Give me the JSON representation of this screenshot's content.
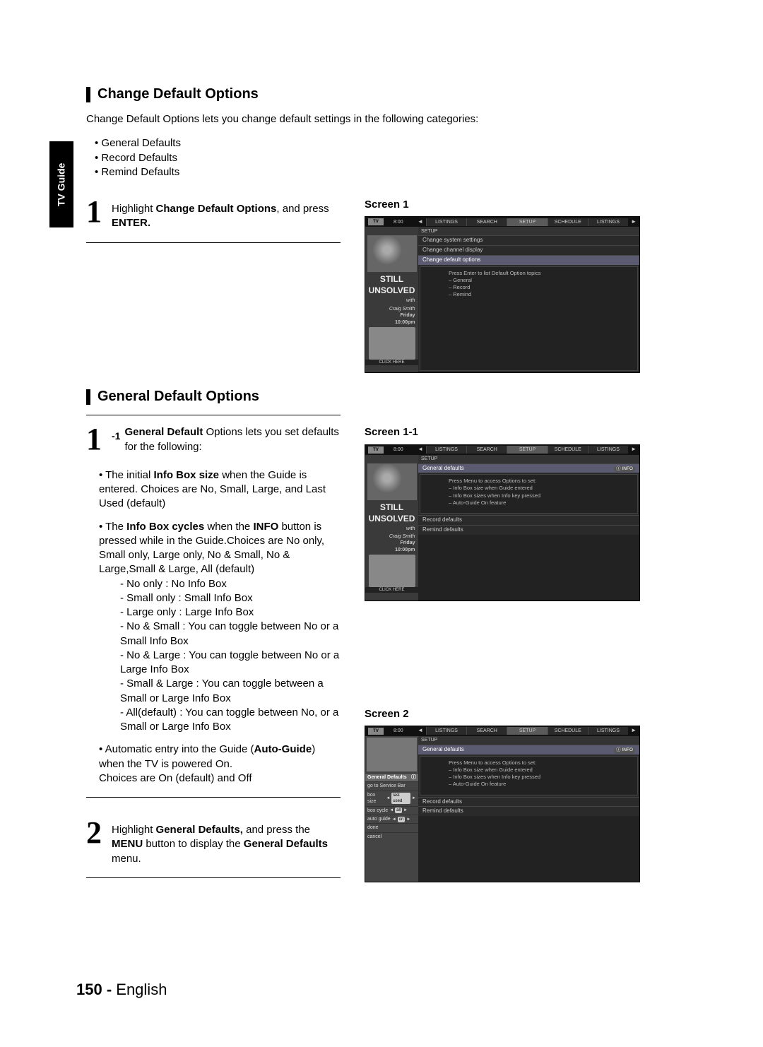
{
  "sideTab": "TV Guide",
  "section1": {
    "title": "Change Default Options",
    "intro": "Change Default Options lets you change default settings in the following categories:",
    "bullets": [
      "• General Defaults",
      "• Record Defaults",
      "• Remind Defaults"
    ],
    "step1": {
      "num": "1",
      "pre": "Highlight ",
      "bold1": "Change Default Options",
      "mid": ", and press ",
      "bold2": "ENTER."
    },
    "screenLabel": "Screen 1"
  },
  "section2": {
    "title": "General Default Options",
    "step1": {
      "num": "1",
      "subnum": "-1",
      "bold1": "General Default",
      "after": " Options lets you set defaults for the following:"
    },
    "b1": {
      "pre": "• The initial ",
      "bold": "Info Box size",
      "after": " when the Guide is entered. Choices are No, Small, Large, and Last Used (default)"
    },
    "b2": {
      "pre": "• The ",
      "bold1": "Info Box cycles",
      "mid": " when the ",
      "bold2": "INFO",
      "after": " button is pressed while in the Guide.Choices are No only, Small only, Large only, No & Small, No & Large,Small & Large, All (default)"
    },
    "b2list": [
      "- No only : No Info Box",
      "- Small only : Small Info Box",
      "- Large only : Large Info Box",
      "- No & Small : You can toggle between No or a Small Info Box",
      "- No & Large : You can toggle between No or a Large Info Box",
      "- Small & Large : You can toggle between a Small or Large Info Box",
      "- All(default) : You can toggle between No, or a Small or Large Info Box"
    ],
    "b3": {
      "pre": "• Automatic entry into the Guide (",
      "bold": "Auto-Guide",
      "mid": ") when the TV is powered On.",
      "after": "Choices are On (default) and Off"
    },
    "step2": {
      "num": "2",
      "pre": "Highlight ",
      "bold1": "General Defaults,",
      "mid": " and press the ",
      "bold2": "MENU",
      "mid2": " button to display the ",
      "bold3": "General Defaults",
      "after": " menu."
    },
    "screenLabel11": "Screen 1-1",
    "screenLabel2": "Screen 2"
  },
  "screens": {
    "logo": "TV",
    "time": "8:00",
    "tabs": [
      "LISTINGS",
      "SEARCH",
      "SETUP",
      "SCHEDULE",
      "LISTINGS"
    ],
    "still1": "STILL",
    "still2": "UNSOLVED",
    "craig": "Craig Smith",
    "with": "with",
    "friday": "Friday",
    "timeShow": "10:00pm",
    "click": "CLICK HERE",
    "arrowL": "◄",
    "arrowR": "►",
    "infoBadge": "ⓘ INFO",
    "s1": {
      "breadcrumb": "SETUP",
      "rows": [
        "Change system settings",
        "Change channel display",
        "Change default options"
      ],
      "paneLines": [
        "Press Enter to list Default Option topics",
        "– General",
        "– Record",
        "– Remind"
      ]
    },
    "s11": {
      "breadcrumb": "SETUP",
      "rows": [
        "General defaults"
      ],
      "paneLines": [
        "Press Menu to access Options to set:",
        "– Info Box size when Guide entered",
        "– Info Box sizes when Info key pressed",
        "– Auto-Guide On feature"
      ],
      "rows2": [
        "Record defaults",
        "Remind defaults"
      ]
    },
    "s2": {
      "breadcrumb": "SETUP",
      "leftMenu": {
        "hd": "General Defaults",
        "goto": "go to Service Bar",
        "boxsizeL": "box size",
        "boxsizeV": "last used",
        "boxcycleL": "box cycle",
        "boxcycleV": "all",
        "autoguideL": "auto guide",
        "autoguideV": "on",
        "done": "done",
        "cancel": "cancel"
      },
      "rows": [
        "General defaults"
      ],
      "paneLines": [
        "Press Menu to access Options to set:",
        "– Info Box size when Guide entered",
        "– Info Box sizes when Info key pressed",
        "– Auto-Guide On feature"
      ],
      "rows2": [
        "Record defaults",
        "Remind defaults"
      ]
    }
  },
  "footer": {
    "page": "150 -",
    "lang": " English"
  }
}
